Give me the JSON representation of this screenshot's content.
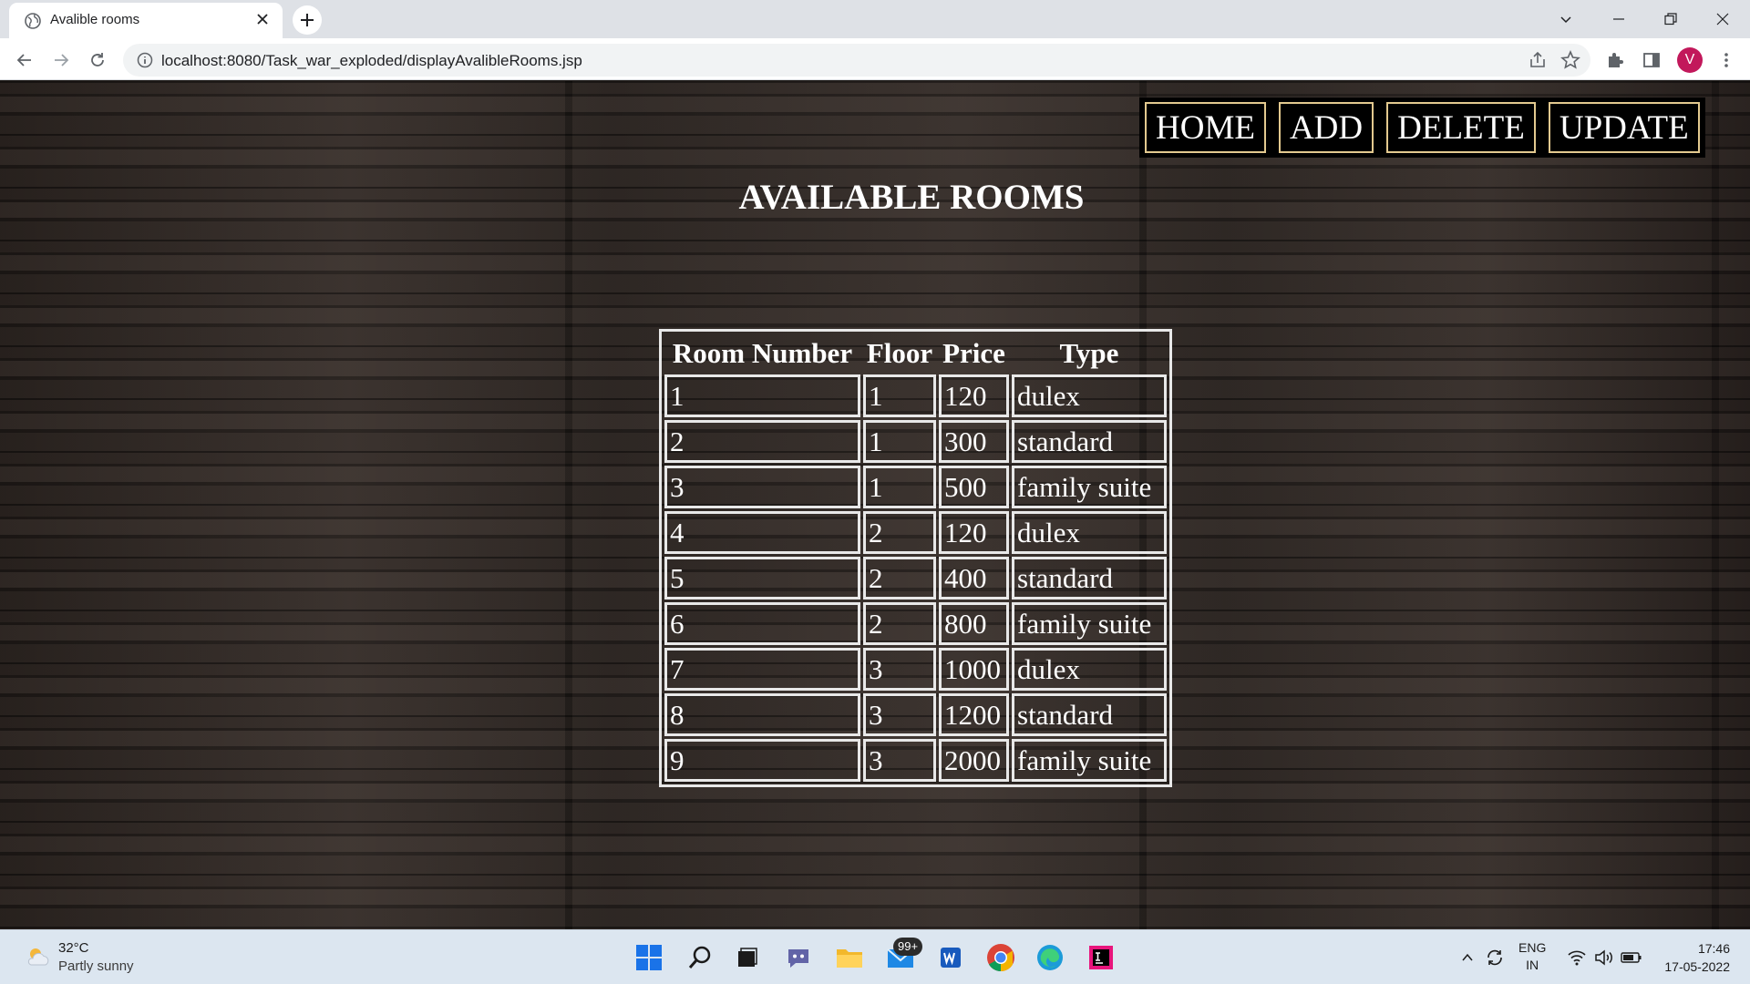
{
  "browser": {
    "tab_title": "Avalible rooms",
    "url": "localhost:8080/Task_war_exploded/displayAvalibleRooms.jsp",
    "profile_initial": "V"
  },
  "nav": {
    "home": "HOME",
    "add": "ADD",
    "delete": "DELETE",
    "update": "UPDATE"
  },
  "page": {
    "title": "AVAILABLE ROOMS"
  },
  "table": {
    "headers": [
      "Room Number",
      "Floor",
      "Price",
      "Type"
    ],
    "rows": [
      [
        "1",
        "1",
        "120",
        "dulex"
      ],
      [
        "2",
        "1",
        "300",
        "standard"
      ],
      [
        "3",
        "1",
        "500",
        "family suite"
      ],
      [
        "4",
        "2",
        "120",
        "dulex"
      ],
      [
        "5",
        "2",
        "400",
        "standard"
      ],
      [
        "6",
        "2",
        "800",
        "family suite"
      ],
      [
        "7",
        "3",
        "1000",
        "dulex"
      ],
      [
        "8",
        "3",
        "1200",
        "standard"
      ],
      [
        "9",
        "3",
        "2000",
        "family suite"
      ]
    ]
  },
  "taskbar": {
    "temperature": "32°C",
    "weather": "Partly sunny",
    "mail_badge": "99+",
    "lang_top": "ENG",
    "lang_bottom": "IN",
    "time": "17:46",
    "date": "17-05-2022"
  },
  "colors": {
    "nav_border": "#e3c98f",
    "table_border": "#e8e8e8",
    "text": "#ffffff"
  }
}
